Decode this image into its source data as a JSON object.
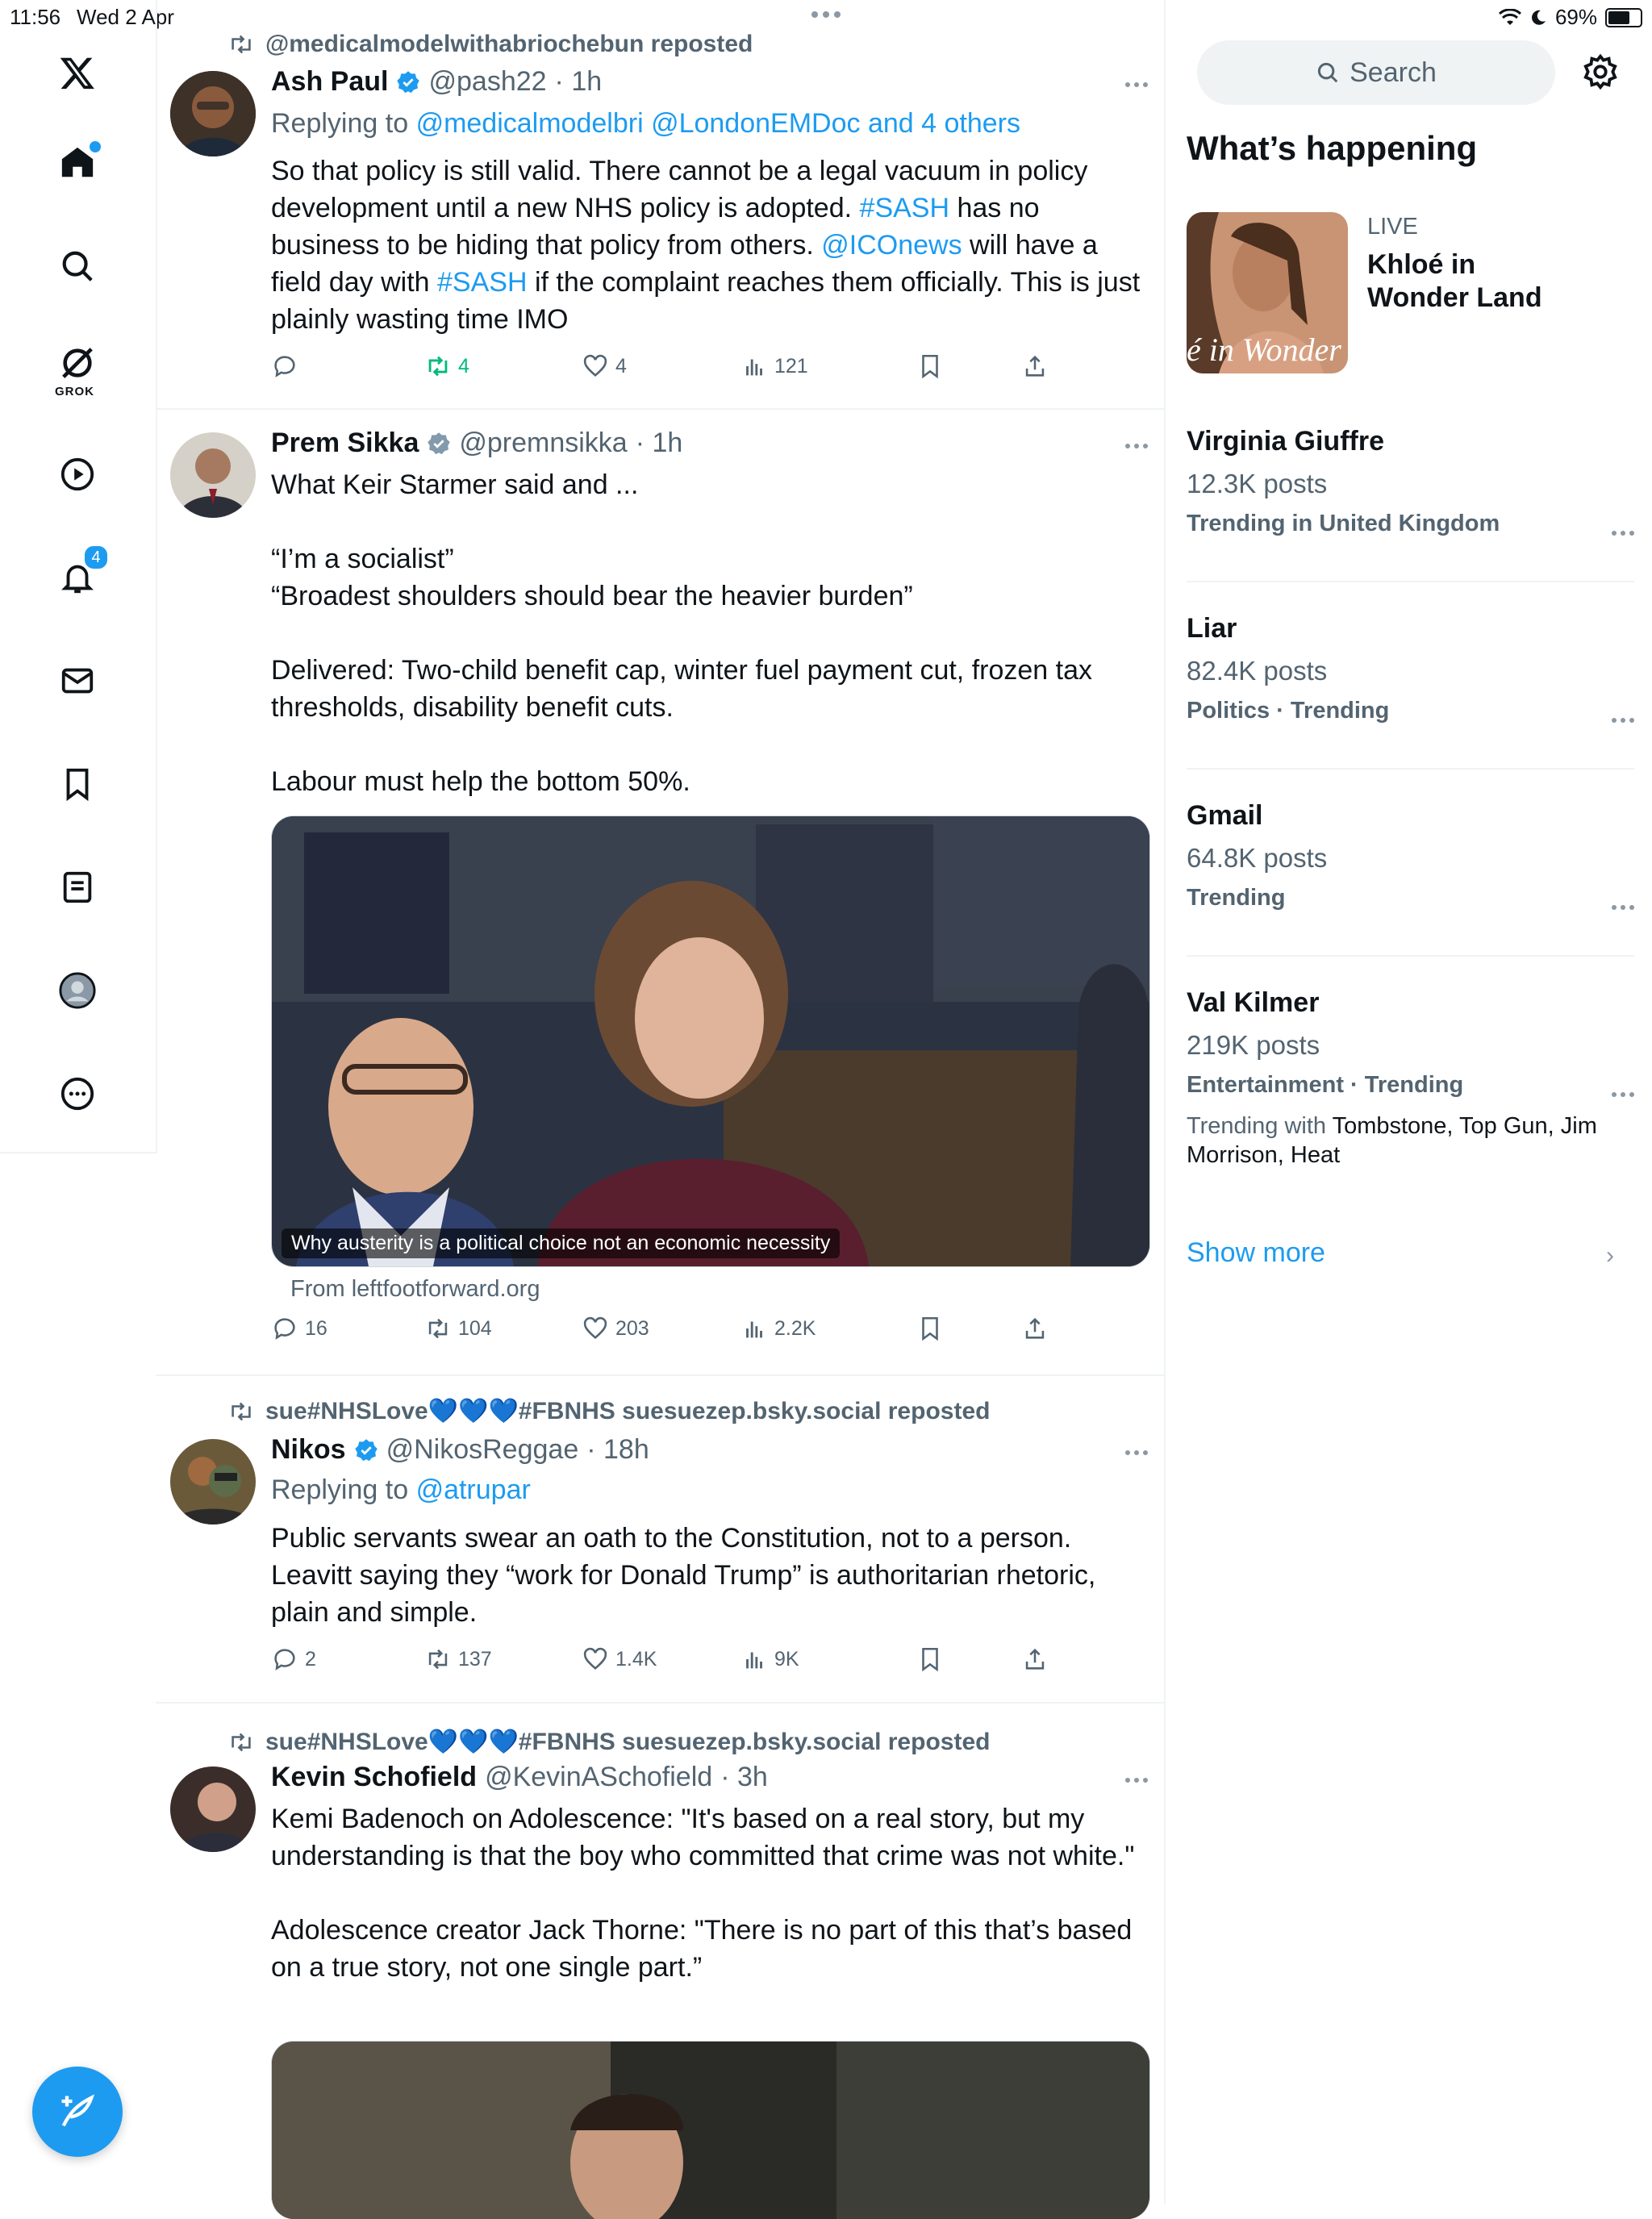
{
  "status": {
    "time": "11:56",
    "date": "Wed 2 Apr",
    "battery": "69%",
    "battery_level": 0.69
  },
  "nav": {
    "grok_label": "GROK",
    "notifications_badge": "4"
  },
  "tweets": [
    {
      "repost": "@medicalmodelwithabriochebun reposted",
      "name": "Ash Paul",
      "handle": "@pash22",
      "time": "· 1h",
      "reply_prefix": "Replying to",
      "reply_to": "@medicalmodelbri @LondonEMDoc and 4 others",
      "text_parts": [
        "So that policy is still valid. There cannot be a legal vacuum in policy development until a new NHS policy is adopted. ",
        "#SASH",
        " has no business to be hiding that policy from others. ",
        "@ICOnews",
        " will have a field day with ",
        "#SASH",
        " if the complaint reaches them officially. This is just plainly wasting time IMO"
      ],
      "replies": "",
      "reposts": "4",
      "likes": "4",
      "views": "121"
    },
    {
      "name": "Prem Sikka",
      "handle": "@premnsikka",
      "time": "· 1h",
      "paragraphs": [
        "What Keir Starmer said and ...",
        "“I’m a socialist”",
        "“Broadest shoulders should bear the heavier burden”",
        "Delivered: Two-child benefit cap, winter fuel payment cut, frozen tax thresholds, disability benefit cuts.",
        "Labour must help the bottom 50%."
      ],
      "media_caption": "Why austerity is a political choice not an economic necessity",
      "from": "From leftfootforward.org",
      "replies": "16",
      "reposts": "104",
      "likes": "203",
      "views": "2.2K"
    },
    {
      "repost": "sue#NHSLove💙💙💙#FBNHS suesuezep.bsky.social reposted",
      "name": "Nikos",
      "handle": "@NikosReggae",
      "time": "· 18h",
      "reply_prefix": "Replying to",
      "reply_to": "@atrupar",
      "text": "Public servants swear an oath to the Constitution, not to a person. Leavitt saying they “work for Donald Trump” is authoritarian rhetoric, plain and simple.",
      "replies": "2",
      "reposts": "137",
      "likes": "1.4K",
      "views": "9K"
    },
    {
      "repost": "sue#NHSLove💙💙💙#FBNHS suesuezep.bsky.social reposted",
      "name": "Kevin Schofield",
      "handle": "@KevinASchofield",
      "time": "· 3h",
      "paragraphs": [
        "Kemi Badenoch on Adolescence: \"It's based on a real story, but my understanding is that the boy who committed that crime was not white.\"",
        "Adolescence creator Jack Thorne: \"There is no part of this that’s based on a true story, not one single part.”"
      ]
    }
  ],
  "sidebar": {
    "search_placeholder": "Search",
    "heading": "What’s happening",
    "live": {
      "label": "LIVE",
      "title": "Khloé in Wonder Land",
      "card_text": "é in Wonder L"
    },
    "trends": [
      {
        "name": "Virginia Giuffre",
        "posts": "12.3K posts",
        "context": "Trending in United Kingdom"
      },
      {
        "name": "Liar",
        "posts": "82.4K posts",
        "context": "Politics · Trending"
      },
      {
        "name": "Gmail",
        "posts": "64.8K posts",
        "context": "Trending"
      },
      {
        "name": "Val Kilmer",
        "posts": "219K posts",
        "context": "Entertainment · Trending",
        "with_label": "Trending with",
        "with_items": "Tombstone, Top Gun, Jim Morrison, Heat"
      }
    ],
    "show_more": "Show more"
  },
  "colors": {
    "accent": "#1d9bf0",
    "repost_active": "#00ba7c",
    "muted": "#536471"
  }
}
